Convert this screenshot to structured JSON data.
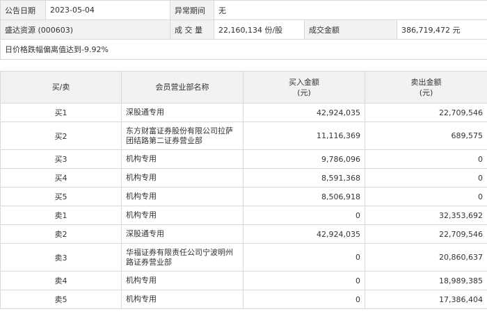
{
  "info": {
    "date_label": "公告日期",
    "date_value": "2023-05-04",
    "period_label": "异常期间",
    "period_value": "无",
    "stock_name": "盛达资源 (000603)",
    "volume_label": "成 交 量",
    "volume_value": "22,160,134 份/股",
    "amount_label": "成交金额",
    "amount_value": "386,719,472 元",
    "reason": "日价格跌幅偏离值达到-9.92%"
  },
  "table": {
    "headers": {
      "side": "买/卖",
      "dept": "会员营业部名称",
      "buy_line1": "买入金额",
      "buy_line2": "(元)",
      "sell_line1": "卖出金额",
      "sell_line2": "(元)"
    },
    "rows": [
      {
        "side": "买1",
        "dept": "深股通专用",
        "buy": "42,924,035",
        "sell": "22,709,546"
      },
      {
        "side": "买2",
        "dept": "东方财富证券股份有限公司拉萨团结路第二证券营业部",
        "buy": "11,116,369",
        "sell": "689,575"
      },
      {
        "side": "买3",
        "dept": "机构专用",
        "buy": "9,786,096",
        "sell": "0"
      },
      {
        "side": "买4",
        "dept": "机构专用",
        "buy": "8,591,368",
        "sell": "0"
      },
      {
        "side": "买5",
        "dept": "机构专用",
        "buy": "8,506,918",
        "sell": "0"
      },
      {
        "side": "卖1",
        "dept": "机构专用",
        "buy": "0",
        "sell": "32,353,692"
      },
      {
        "side": "卖2",
        "dept": "深股通专用",
        "buy": "42,924,035",
        "sell": "22,709,546"
      },
      {
        "side": "卖3",
        "dept": "华福证券有限责任公司宁波明州路证券营业部",
        "buy": "0",
        "sell": "20,860,637"
      },
      {
        "side": "卖4",
        "dept": "机构专用",
        "buy": "0",
        "sell": "18,989,385"
      },
      {
        "side": "卖5",
        "dept": "机构专用",
        "buy": "0",
        "sell": "17,386,404"
      }
    ]
  }
}
